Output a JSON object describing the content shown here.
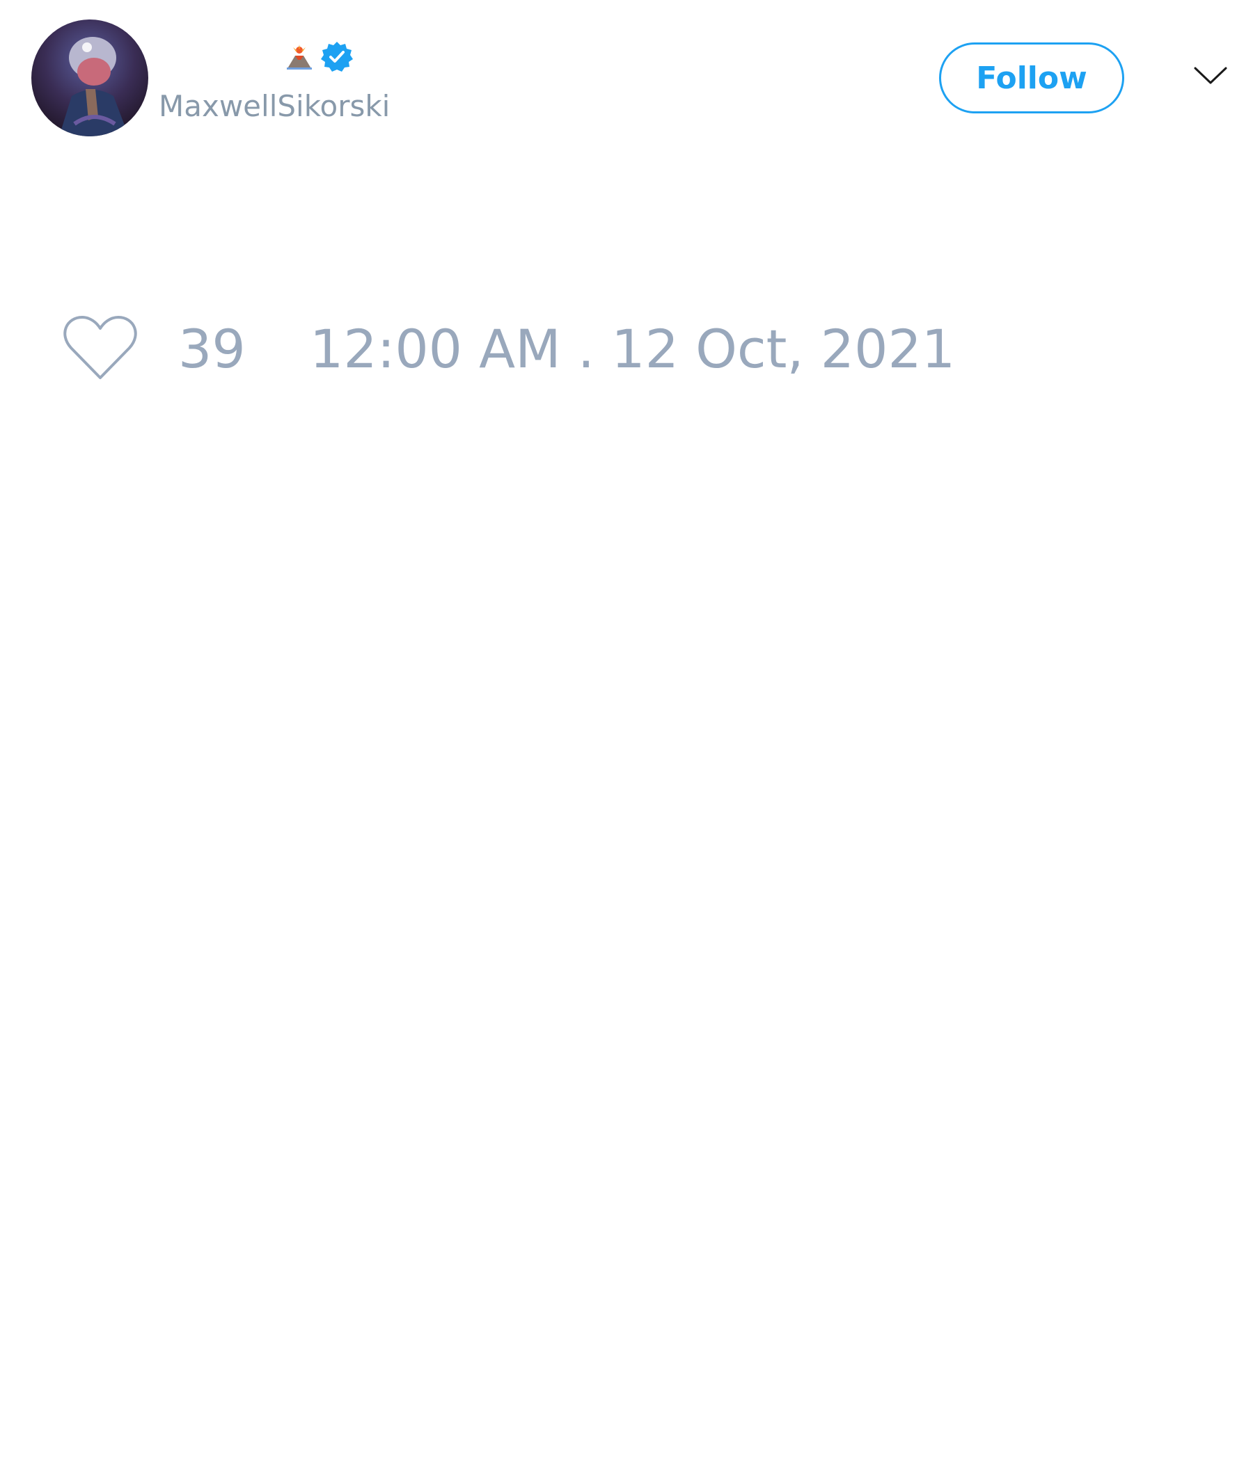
{
  "author": {
    "display_name_emoji": "volcano-emoji",
    "verified_icon": "verified-badge-icon",
    "handle": "MaxwellSikorski"
  },
  "follow_button": {
    "label": "Follow"
  },
  "menu": {
    "icon": "chevron-down-icon"
  },
  "stats": {
    "like_icon": "heart-outline-icon",
    "like_count": "39",
    "timestamp": "12:00 AM . 12 Oct, 2021"
  },
  "colors": {
    "accent": "#1da1f2",
    "muted_text": "#99a8bc",
    "background": "#ffffff"
  }
}
